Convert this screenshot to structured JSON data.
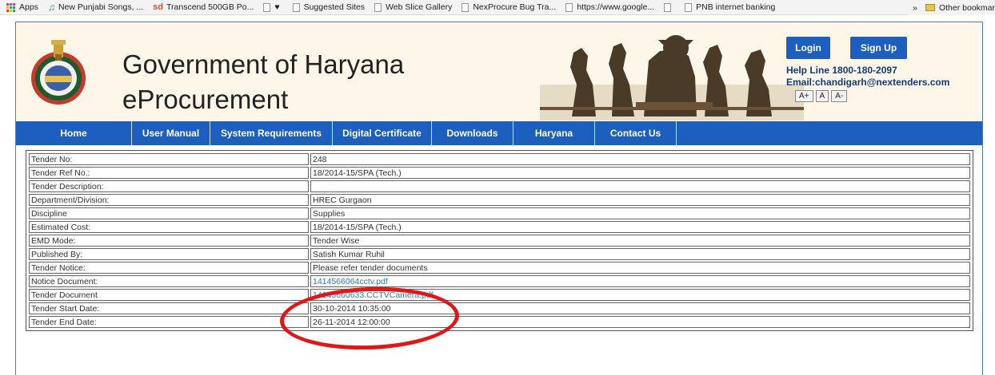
{
  "bookmarks": {
    "items": [
      {
        "label": "Apps",
        "icon": "apps-icon"
      },
      {
        "label": "New Punjabi Songs, ...",
        "icon": "music-icon"
      },
      {
        "label": "Transcend 500GB Po...",
        "icon": "sd-icon"
      },
      {
        "label": "",
        "icon": "heart-icon"
      },
      {
        "label": "Suggested Sites",
        "icon": "page-icon"
      },
      {
        "label": "Web Slice Gallery",
        "icon": "page-icon"
      },
      {
        "label": "NexProcure Bug Tra...",
        "icon": "page-icon"
      },
      {
        "label": "https://www.google...",
        "icon": "page-icon"
      },
      {
        "label": "",
        "icon": "page-icon"
      },
      {
        "label": "PNB internet banking",
        "icon": "page-icon"
      }
    ],
    "overflow": "»",
    "other": "Other bookmar"
  },
  "header": {
    "title_line1": "Government of Haryana",
    "title_line2": "eProcurement",
    "login_label": "Login",
    "signup_label": "Sign Up",
    "helpline": "Help Line 1800-180-2097",
    "email": "Email:chandigarh@nextenders.com",
    "font_larger": "A+",
    "font_normal": "A",
    "font_smaller": "A-"
  },
  "nav": {
    "items": [
      "Home",
      "User Manual",
      "System Requirements",
      "Digital Certificate",
      "Downloads",
      "Haryana",
      "Contact Us"
    ]
  },
  "tender": {
    "rows": [
      {
        "label": "Tender No:",
        "value": "248"
      },
      {
        "label": "Tender Ref No.:",
        "value": "18/2014-15/SPA (Tech.)"
      },
      {
        "label": "Tender Description:",
        "value": ""
      },
      {
        "label": "Department/Division:",
        "value": "HREC Gurgaon"
      },
      {
        "label": "Discipline",
        "value": "Supplies"
      },
      {
        "label": "Estimated Cost:",
        "value": "18/2014-15/SPA (Tech.)"
      },
      {
        "label": "EMD Mode:",
        "value": "Tender Wise"
      },
      {
        "label": "Published By:",
        "value": "Satish Kumar Ruhil"
      },
      {
        "label": "Tender Notice:",
        "value": "Please refer tender documents"
      },
      {
        "label": "Notice Document:",
        "value": "1414566064cctv.pdf"
      },
      {
        "label": "Tender Document",
        "value": "14145660633.CCTVCamera.pdf"
      },
      {
        "label": "Tender Start Date:",
        "value": "30-10-2014 10:35:00"
      },
      {
        "label": "Tender End Date:",
        "value": "26-11-2014 12:00:00"
      }
    ]
  },
  "colors": {
    "nav_bg": "#1c5fbf",
    "banner_bg": "#fdf6e9",
    "link": "#2f78c4",
    "highlight_circle": "#e11616"
  }
}
